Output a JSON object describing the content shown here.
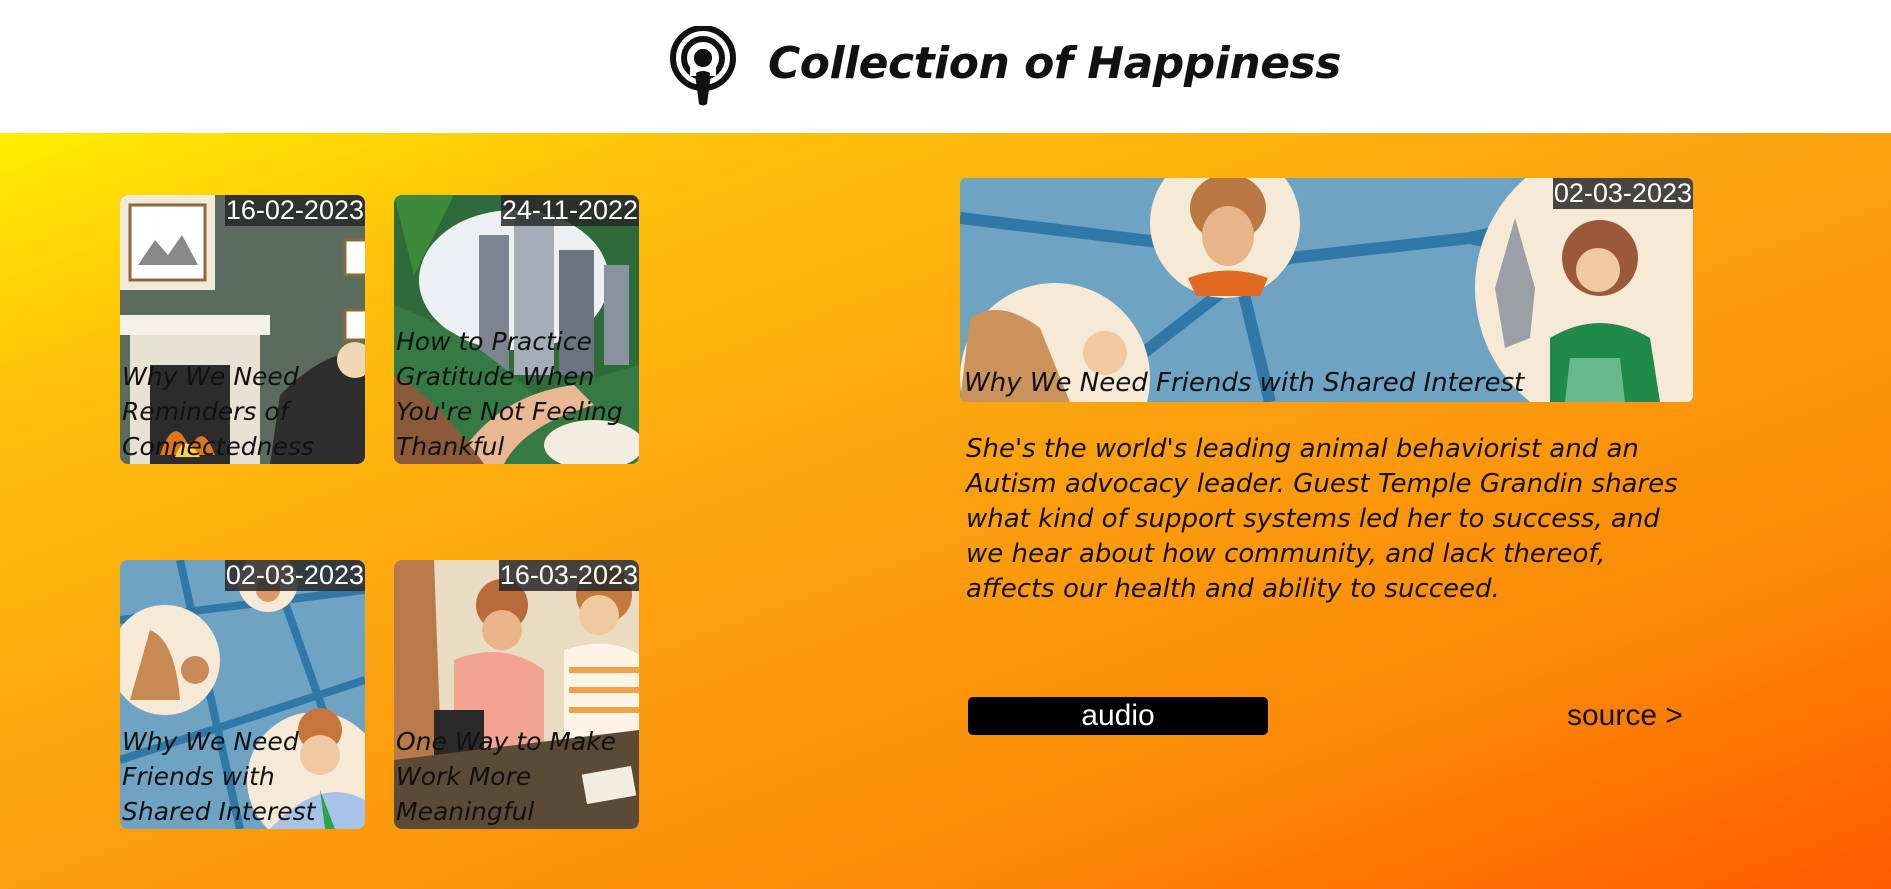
{
  "header": {
    "title": "Collection of Happiness",
    "logo_icon": "podcast-icon"
  },
  "episodes": [
    {
      "date": "16-02-2023",
      "title": "Why We Need Reminders of Connectedness"
    },
    {
      "date": "24-11-2022",
      "title": "How to Practice Gratitude When You're Not Feeling Thankful"
    },
    {
      "date": "02-03-2023",
      "title": "Why We Need Friends with Shared Interest"
    },
    {
      "date": "16-03-2023",
      "title": "One Way to Make Work More Meaningful"
    }
  ],
  "featured": {
    "date": "02-03-2023",
    "title": "Why We Need Friends with Shared Interest",
    "description": "She's the world's leading animal behaviorist and an Autism advocacy leader. Guest Temple Grandin shares what kind of support systems led her to success, and we hear about how community, and lack thereof, affects our health and ability to succeed.",
    "audio_label": "audio",
    "source_label": "source >"
  },
  "colors": {
    "gradient_start": "#ffee00",
    "gradient_end": "#ff5a00",
    "date_badge_bg": "#282828",
    "audio_button_bg": "#000000"
  }
}
